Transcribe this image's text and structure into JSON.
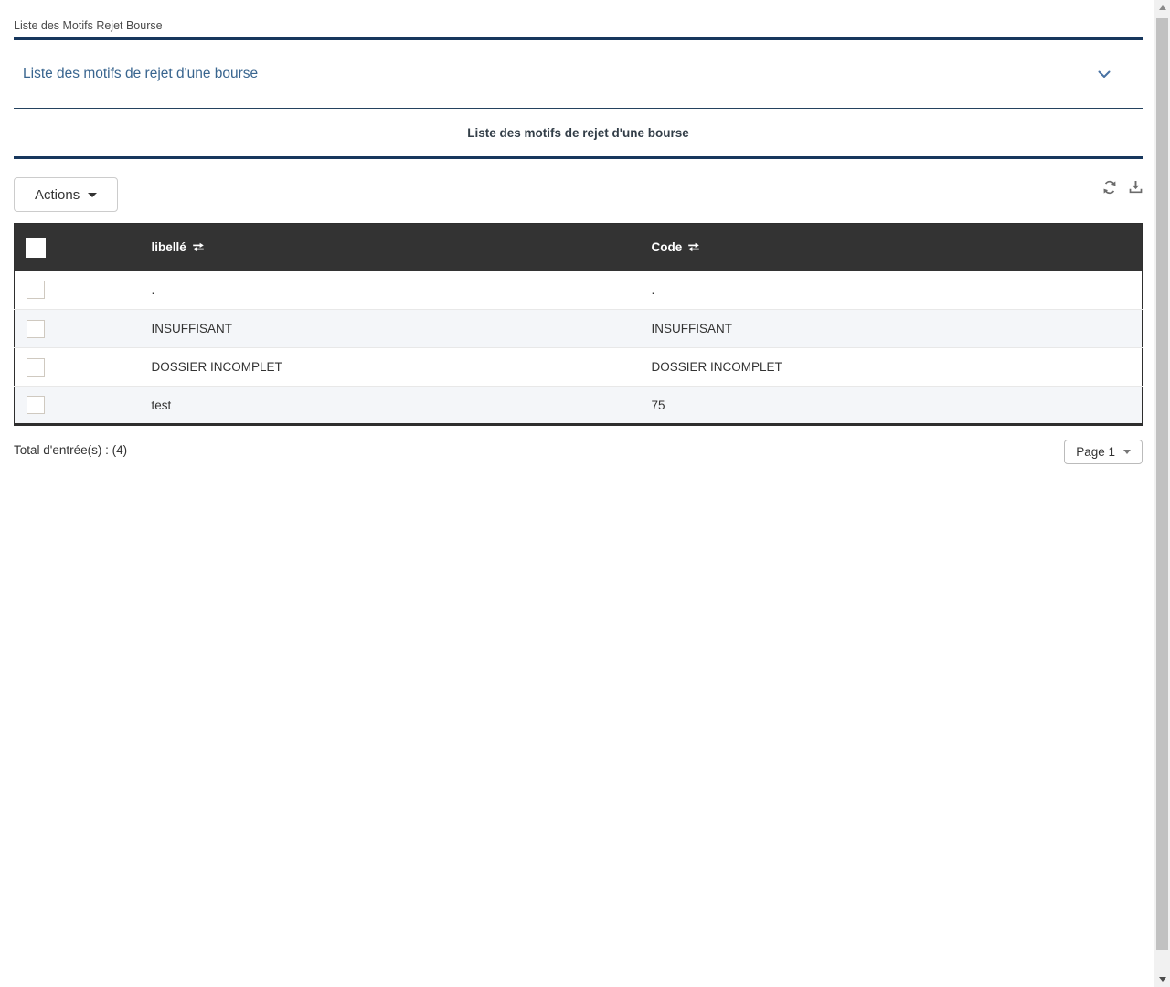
{
  "page": {
    "title": "Liste des Motifs Rejet Bourse"
  },
  "panel": {
    "header_label": "Liste des motifs de rejet d'une bourse"
  },
  "section": {
    "heading": "Liste des motifs de rejet d'une bourse"
  },
  "toolbar": {
    "actions_label": "Actions",
    "icons": [
      {
        "name": "refresh-icon"
      },
      {
        "name": "download-icon"
      }
    ]
  },
  "table": {
    "columns": [
      {
        "label": "libellé",
        "sortable": true
      },
      {
        "label": "Code",
        "sortable": true
      }
    ],
    "rows": [
      {
        "libelle": ".",
        "code": "."
      },
      {
        "libelle": "INSUFFISANT",
        "code": "INSUFFISANT"
      },
      {
        "libelle": "DOSSIER INCOMPLET",
        "code": "DOSSIER INCOMPLET"
      },
      {
        "libelle": "test",
        "code": "75"
      }
    ]
  },
  "footer": {
    "total_label": "Total d'entrée(s) : (4)",
    "page_button_label": "Page 1"
  },
  "colors": {
    "accent_navy": "#17375d",
    "table_header_bg": "#333333",
    "alt_row_bg": "#f4f6f9",
    "panel_link_blue": "#39658f"
  }
}
